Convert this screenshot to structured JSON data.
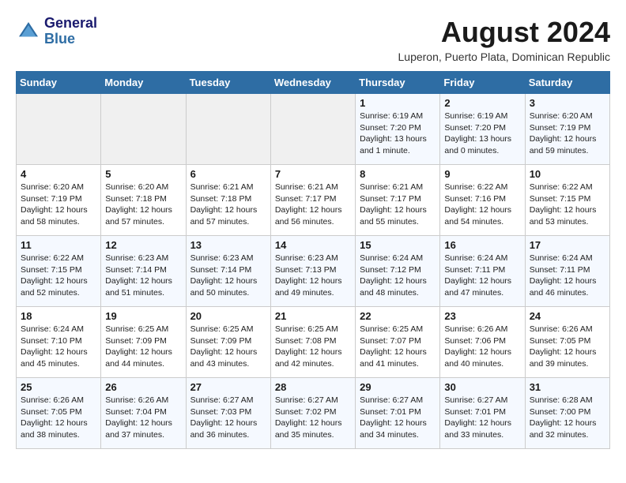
{
  "header": {
    "logo_line1": "General",
    "logo_line2": "Blue",
    "month_year": "August 2024",
    "location": "Luperon, Puerto Plata, Dominican Republic"
  },
  "days_of_week": [
    "Sunday",
    "Monday",
    "Tuesday",
    "Wednesday",
    "Thursday",
    "Friday",
    "Saturday"
  ],
  "weeks": [
    [
      {
        "day": "",
        "info": ""
      },
      {
        "day": "",
        "info": ""
      },
      {
        "day": "",
        "info": ""
      },
      {
        "day": "",
        "info": ""
      },
      {
        "day": "1",
        "info": "Sunrise: 6:19 AM\nSunset: 7:20 PM\nDaylight: 13 hours\nand 1 minute."
      },
      {
        "day": "2",
        "info": "Sunrise: 6:19 AM\nSunset: 7:20 PM\nDaylight: 13 hours\nand 0 minutes."
      },
      {
        "day": "3",
        "info": "Sunrise: 6:20 AM\nSunset: 7:19 PM\nDaylight: 12 hours\nand 59 minutes."
      }
    ],
    [
      {
        "day": "4",
        "info": "Sunrise: 6:20 AM\nSunset: 7:19 PM\nDaylight: 12 hours\nand 58 minutes."
      },
      {
        "day": "5",
        "info": "Sunrise: 6:20 AM\nSunset: 7:18 PM\nDaylight: 12 hours\nand 57 minutes."
      },
      {
        "day": "6",
        "info": "Sunrise: 6:21 AM\nSunset: 7:18 PM\nDaylight: 12 hours\nand 57 minutes."
      },
      {
        "day": "7",
        "info": "Sunrise: 6:21 AM\nSunset: 7:17 PM\nDaylight: 12 hours\nand 56 minutes."
      },
      {
        "day": "8",
        "info": "Sunrise: 6:21 AM\nSunset: 7:17 PM\nDaylight: 12 hours\nand 55 minutes."
      },
      {
        "day": "9",
        "info": "Sunrise: 6:22 AM\nSunset: 7:16 PM\nDaylight: 12 hours\nand 54 minutes."
      },
      {
        "day": "10",
        "info": "Sunrise: 6:22 AM\nSunset: 7:15 PM\nDaylight: 12 hours\nand 53 minutes."
      }
    ],
    [
      {
        "day": "11",
        "info": "Sunrise: 6:22 AM\nSunset: 7:15 PM\nDaylight: 12 hours\nand 52 minutes."
      },
      {
        "day": "12",
        "info": "Sunrise: 6:23 AM\nSunset: 7:14 PM\nDaylight: 12 hours\nand 51 minutes."
      },
      {
        "day": "13",
        "info": "Sunrise: 6:23 AM\nSunset: 7:14 PM\nDaylight: 12 hours\nand 50 minutes."
      },
      {
        "day": "14",
        "info": "Sunrise: 6:23 AM\nSunset: 7:13 PM\nDaylight: 12 hours\nand 49 minutes."
      },
      {
        "day": "15",
        "info": "Sunrise: 6:24 AM\nSunset: 7:12 PM\nDaylight: 12 hours\nand 48 minutes."
      },
      {
        "day": "16",
        "info": "Sunrise: 6:24 AM\nSunset: 7:11 PM\nDaylight: 12 hours\nand 47 minutes."
      },
      {
        "day": "17",
        "info": "Sunrise: 6:24 AM\nSunset: 7:11 PM\nDaylight: 12 hours\nand 46 minutes."
      }
    ],
    [
      {
        "day": "18",
        "info": "Sunrise: 6:24 AM\nSunset: 7:10 PM\nDaylight: 12 hours\nand 45 minutes."
      },
      {
        "day": "19",
        "info": "Sunrise: 6:25 AM\nSunset: 7:09 PM\nDaylight: 12 hours\nand 44 minutes."
      },
      {
        "day": "20",
        "info": "Sunrise: 6:25 AM\nSunset: 7:09 PM\nDaylight: 12 hours\nand 43 minutes."
      },
      {
        "day": "21",
        "info": "Sunrise: 6:25 AM\nSunset: 7:08 PM\nDaylight: 12 hours\nand 42 minutes."
      },
      {
        "day": "22",
        "info": "Sunrise: 6:25 AM\nSunset: 7:07 PM\nDaylight: 12 hours\nand 41 minutes."
      },
      {
        "day": "23",
        "info": "Sunrise: 6:26 AM\nSunset: 7:06 PM\nDaylight: 12 hours\nand 40 minutes."
      },
      {
        "day": "24",
        "info": "Sunrise: 6:26 AM\nSunset: 7:05 PM\nDaylight: 12 hours\nand 39 minutes."
      }
    ],
    [
      {
        "day": "25",
        "info": "Sunrise: 6:26 AM\nSunset: 7:05 PM\nDaylight: 12 hours\nand 38 minutes."
      },
      {
        "day": "26",
        "info": "Sunrise: 6:26 AM\nSunset: 7:04 PM\nDaylight: 12 hours\nand 37 minutes."
      },
      {
        "day": "27",
        "info": "Sunrise: 6:27 AM\nSunset: 7:03 PM\nDaylight: 12 hours\nand 36 minutes."
      },
      {
        "day": "28",
        "info": "Sunrise: 6:27 AM\nSunset: 7:02 PM\nDaylight: 12 hours\nand 35 minutes."
      },
      {
        "day": "29",
        "info": "Sunrise: 6:27 AM\nSunset: 7:01 PM\nDaylight: 12 hours\nand 34 minutes."
      },
      {
        "day": "30",
        "info": "Sunrise: 6:27 AM\nSunset: 7:01 PM\nDaylight: 12 hours\nand 33 minutes."
      },
      {
        "day": "31",
        "info": "Sunrise: 6:28 AM\nSunset: 7:00 PM\nDaylight: 12 hours\nand 32 minutes."
      }
    ]
  ]
}
